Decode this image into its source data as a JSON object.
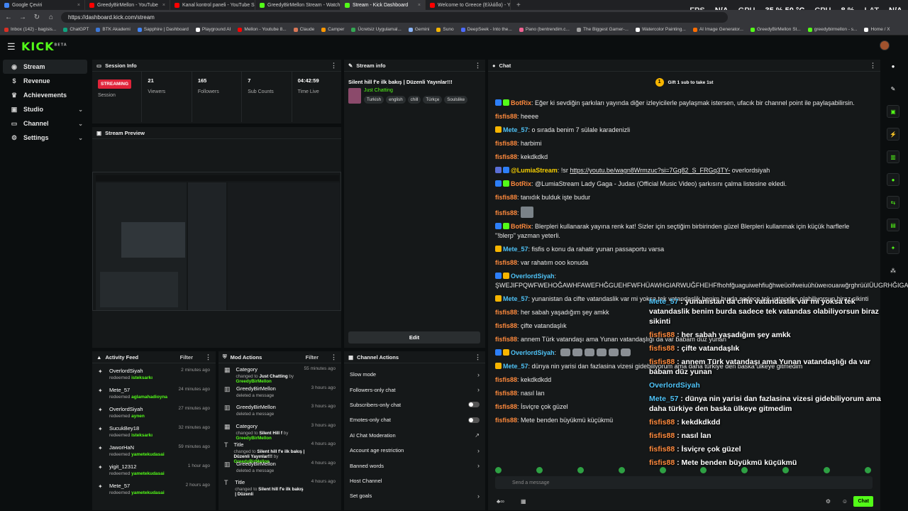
{
  "browser": {
    "tabs": [
      {
        "label": "Google Çeviri",
        "color": "#4285f4"
      },
      {
        "label": "GreedyBirMellon - YouTube",
        "color": "#ff0000"
      },
      {
        "label": "Kanal kontrol paneli - YouTube S...",
        "color": "#ff0000"
      },
      {
        "label": "GreedyBirMellon Stream - Watch...",
        "color": "#53fc18"
      },
      {
        "label": "Stream - Kick Dashboard",
        "color": "#53fc18"
      },
      {
        "label": "Welcome to Greece (Ελλάδα) - Yo...",
        "color": "#ff0000"
      }
    ],
    "url": "https://dashboard.kick.com/stream",
    "bookmarks": [
      "Inbox (142) - bagisis...",
      "ChatGPT",
      "BTK Akademi",
      "Sapphire | Dashboard",
      "Playground AI",
      "Mellon - Youtube 8...",
      "Claude",
      "Camper",
      "Ücretsiz Uygulamal...",
      "Gemini",
      "Suno",
      "DeepSeek - Into the...",
      "Pano (bentrendim.c...",
      "The Biggest Gamer-...",
      "Watercolor Painting...",
      "AI Image Generator...",
      "GreedyBirMellon St...",
      "greedybirmellon - s...",
      "Home / X"
    ]
  },
  "hud": {
    "fps_label": "FPS",
    "fps": "N/A",
    "gpu_label": "GPU",
    "gpu": "35 % 50 °C",
    "cpu_label": "CPU",
    "cpu": "8 %",
    "lat_label": "LAT",
    "lat": "N/A"
  },
  "app": {
    "logo": "KICK",
    "logo_tag": "BETA"
  },
  "sidebar": {
    "items": [
      {
        "label": "Stream",
        "icon": "broadcast-icon",
        "glyph": "◉"
      },
      {
        "label": "Revenue",
        "icon": "dollar-icon",
        "glyph": "$"
      },
      {
        "label": "Achievements",
        "icon": "trophy-icon",
        "glyph": "♛"
      },
      {
        "label": "Studio",
        "icon": "studio-icon",
        "glyph": "▣"
      },
      {
        "label": "Channel",
        "icon": "channel-icon",
        "glyph": "▭"
      },
      {
        "label": "Settings",
        "icon": "gear-icon",
        "glyph": "⚙"
      }
    ]
  },
  "session": {
    "title": "Session Info",
    "status": "STREAMING",
    "session_label": "Session",
    "viewers": "21",
    "viewers_label": "Viewers",
    "followers": "165",
    "followers_label": "Followers",
    "subs": "7",
    "subs_label": "Sub Counts",
    "time": "04:42:59",
    "time_label": "Time Live"
  },
  "stream_info": {
    "title": "Stream info",
    "stream_title": "Silent hill f'e ilk bakış | Düzenli Yayınlar!!!",
    "category": "Just Chatting",
    "tags": [
      "Turkish",
      "english",
      "chill",
      "Türkçe",
      "Soulslike"
    ],
    "edit_label": "Edit"
  },
  "preview": {
    "title": "Stream Preview"
  },
  "activity": {
    "title": "Activity Feed",
    "filter_label": "Filter",
    "items": [
      {
        "name": "OverlordSiyah",
        "action": "redeemed",
        "reward": "isteksarkı",
        "time": "2 minutes ago"
      },
      {
        "name": "Mete_57",
        "action": "redeemed",
        "reward": "aglamahadioyna",
        "time": "24 minutes ago"
      },
      {
        "name": "OverlordSiyah",
        "action": "redeemed",
        "reward": "aynen",
        "time": "27 minutes ago"
      },
      {
        "name": "SucukBey18",
        "action": "redeemed",
        "reward": "isteksarkı",
        "time": "32 minutes ago"
      },
      {
        "name": "JaworHaN",
        "action": "redeemed",
        "reward": "yametekudasai",
        "time": "59 minutes ago"
      },
      {
        "name": "yigit_12312",
        "action": "redeemed",
        "reward": "yametekudasai",
        "time": "1 hour ago"
      },
      {
        "name": "Mete_57",
        "action": "redeemed",
        "reward": "yametekudasai",
        "time": "2 hours ago"
      }
    ]
  },
  "mod_actions": {
    "title": "Mod Actions",
    "filter_label": "Filter",
    "items": [
      {
        "name": "Category",
        "pre": "changed to",
        "target": "Just Chatting",
        "by": "by",
        "who": "GreedyBirMellon",
        "time": "55 minutes ago",
        "glyph": "▦"
      },
      {
        "name": "GreedyBirMellon",
        "pre": "deleted a message",
        "target": "",
        "by": "",
        "who": "",
        "time": "3 hours ago",
        "glyph": "🗑"
      },
      {
        "name": "GreedyBirMellon",
        "pre": "deleted a message",
        "target": "",
        "by": "",
        "who": "",
        "time": "3 hours ago",
        "glyph": "🗑"
      },
      {
        "name": "Category",
        "pre": "changed to",
        "target": "Silent Hill f",
        "by": "by",
        "who": "GreedyBirMellon",
        "time": "3 hours ago",
        "glyph": "▦"
      },
      {
        "name": "Title",
        "pre": "changed to",
        "target": "Silent hill f'e ilk bakış | Düzenli Yayınlar!!!",
        "by": "by",
        "who": "GreedyBirMellon",
        "time": "4 hours ago",
        "glyph": "T"
      },
      {
        "name": "GreedyBirMellon",
        "pre": "deleted a message",
        "target": "",
        "by": "",
        "who": "",
        "time": "4 hours ago",
        "glyph": "🗑"
      },
      {
        "name": "Title",
        "pre": "changed to",
        "target": "Silent hill f'e ilk bakış | Düzenli",
        "by": "",
        "who": "",
        "time": "4 hours ago",
        "glyph": "T"
      }
    ]
  },
  "channel_actions": {
    "title": "Channel Actions",
    "items": [
      {
        "label": "Slow mode",
        "kind": "arrow"
      },
      {
        "label": "Followers-only chat",
        "kind": "arrow"
      },
      {
        "label": "Subscribers-only chat",
        "kind": "toggle"
      },
      {
        "label": "Emotes-only chat",
        "kind": "toggle"
      },
      {
        "label": "AI Chat Moderation",
        "kind": "external"
      },
      {
        "label": "Account age restriction",
        "kind": "arrow"
      },
      {
        "label": "Banned words",
        "kind": "arrow"
      },
      {
        "label": "Host Channel",
        "kind": "none"
      },
      {
        "label": "Set goals",
        "kind": "arrow"
      }
    ]
  },
  "chat": {
    "title": "Chat",
    "pin_coin": "1",
    "pin_text": "Gift 1 sub to take 1st",
    "input_placeholder": "Send a message",
    "send_label": "Chat",
    "messages": [
      {
        "user": "BotRix",
        "color": "#ff8a3d",
        "badges": [
          "#2d7ff9",
          "#53fc18"
        ],
        "text": "Eğer ki sevdiğin şarkıları yayında diğer izleyicilerle paylaşmak istersen, ufacık bir channel point ile paylaşabilirsin.",
        "link": ""
      },
      {
        "user": "fisfis88",
        "color": "#ff8a3d",
        "badges": [],
        "text": "heeee",
        "link": ""
      },
      {
        "user": "Mete_57",
        "color": "#4fc3f7",
        "badges": [
          "#f7b500"
        ],
        "text": "o sırada benim 7 sülale karadenizli",
        "link": ""
      },
      {
        "user": "fisfis88",
        "color": "#ff8a3d",
        "badges": [],
        "text": "harbimi",
        "link": ""
      },
      {
        "user": "fisfis88",
        "color": "#ff8a3d",
        "badges": [],
        "text": "kekdkdkd",
        "link": ""
      },
      {
        "user": "@LumiaStream",
        "color": "#f7d000",
        "badges": [
          "#5a6fd6",
          "#2d7ff9"
        ],
        "text": "!sr",
        "link": "https://youtu.be/wagn8Wrmzuc?si=7Gq82_S_FRGq3TY-",
        "after": " overlordsiyah"
      },
      {
        "user": "BotRix",
        "color": "#ff8a3d",
        "badges": [
          "#2d7ff9",
          "#53fc18"
        ],
        "text": "@LumiaStream Lady Gaga - Judas (Official Music Video) şarkısını çalma listesine ekledi.",
        "link": ""
      },
      {
        "user": "fisfis88",
        "color": "#ff8a3d",
        "badges": [],
        "text": "tanıdık bulduk işte budur",
        "link": ""
      },
      {
        "user": "fisfis88",
        "color": "#ff8a3d",
        "badges": [],
        "text": "",
        "link": "",
        "sticker": true
      },
      {
        "user": "BotRix",
        "color": "#ff8a3d",
        "badges": [
          "#2d7ff9",
          "#53fc18"
        ],
        "text": "Blerpleri kullanarak yayına renk kat! Sizler için seçtiğim birbirinden güzel Blerpleri kullanmak için küçük harflerle \"!blerp\" yazman yeterli.",
        "link": ""
      },
      {
        "user": "Mete_57",
        "color": "#4fc3f7",
        "badges": [
          "#f7b500"
        ],
        "text": "fisfis o konu da rahatir yunan passaportu varsa",
        "link": ""
      },
      {
        "user": "fisfis88",
        "color": "#ff8a3d",
        "badges": [],
        "text": "var rahatım ooo konuda",
        "link": ""
      },
      {
        "user": "OverlordSiyah",
        "color": "#4fc3f7",
        "badges": [
          "#2d7ff9",
          "#f7b500"
        ],
        "text": "ŞWEJIFPQWFWEHOĞAWHFAWEFHĞGUEHFWFHÜAWHGIARWUĞFHEHFfhohfğuaguiwehfiuğhweüoifweiuühüweıouaıwğrghrüüIÜUGRHĞIGAWEIÜÜ",
        "link": ""
      },
      {
        "user": "Mete_57",
        "color": "#4fc3f7",
        "badges": [
          "#f7b500"
        ],
        "text": "yunanistan da cifte vatandaslik var mi yoksa tek vatandaslik benim burda sadece tek vatandas olabiliyorsun biraz sikinti",
        "link": ""
      },
      {
        "user": "fisfis88",
        "color": "#ff8a3d",
        "badges": [],
        "text": "her sabah yaşadığım şey amkk",
        "link": ""
      },
      {
        "user": "fisfis88",
        "color": "#ff8a3d",
        "badges": [],
        "text": "çifte vatandaşlık",
        "link": ""
      },
      {
        "user": "fisfis88",
        "color": "#ff8a3d",
        "badges": [],
        "text": "annem Türk vatandaşı ama Yunan vatandaşlığı da var babam düz yunan",
        "link": ""
      },
      {
        "user": "OverlordSiyah",
        "color": "#4fc3f7",
        "badges": [
          "#2d7ff9",
          "#f7b500"
        ],
        "text": "",
        "link": "",
        "emotes": 6
      },
      {
        "user": "Mete_57",
        "color": "#4fc3f7",
        "badges": [
          "#f7b500"
        ],
        "text": "dünya nin yarisi dan fazlasina vizesi gidebiliyorum ama daha türkiye den baska ülkeye gitmedim",
        "link": ""
      },
      {
        "user": "fisfis88",
        "color": "#ff8a3d",
        "badges": [],
        "text": "kekdkdkdd",
        "link": ""
      },
      {
        "user": "fisfis88",
        "color": "#ff8a3d",
        "badges": [],
        "text": "nasıl lan",
        "link": ""
      },
      {
        "user": "fisfis88",
        "color": "#ff8a3d",
        "badges": [],
        "text": "İsviçre çok güzel",
        "link": ""
      },
      {
        "user": "fisfis88",
        "color": "#ff8a3d",
        "badges": [],
        "text": "Mete benden büyükmü küçükmü",
        "link": ""
      }
    ],
    "overlay": [
      {
        "user": "Mete_57",
        "blue": true,
        "text": "yunanistan da cifte vatandaslik var mi yoksa tek vatandaslik benim burda sadece tek vatandas olabiliyorsun biraz sikinti"
      },
      {
        "user": "fisfis88",
        "blue": false,
        "text": "her sabah yaşadığım şey amkk"
      },
      {
        "user": "fisfis88",
        "blue": false,
        "text": "çifte vatandaşlık"
      },
      {
        "user": "fisfis88",
        "blue": false,
        "text": "annem Türk vatandaşı ama Yunan vatandaşlığı da var babam düz yunan"
      },
      {
        "user": "OverlordSiyah",
        "blue": true,
        "text": ""
      },
      {
        "user": "Mete_57",
        "blue": true,
        "text": "dünya nin yarisi dan fazlasina vizesi gidebiliyorum ama daha türkiye den baska ülkeye gitmedim"
      },
      {
        "user": "fisfis88",
        "blue": false,
        "text": "kekdkdkdd"
      },
      {
        "user": "fisfis88",
        "blue": false,
        "text": "nasıl lan"
      },
      {
        "user": "fisfis88",
        "blue": false,
        "text": "İsviçre çok güzel"
      },
      {
        "user": "fisfis88",
        "blue": false,
        "text": "Mete benden büyükmü küçükmü"
      }
    ]
  },
  "rail": {
    "items": [
      {
        "icon": "info-icon",
        "glyph": "●",
        "white": true
      },
      {
        "icon": "pencil-icon",
        "glyph": "✎",
        "white": true
      },
      {
        "icon": "layout-icon",
        "glyph": "▣",
        "white": false
      },
      {
        "icon": "bolt-icon",
        "glyph": "⚡",
        "white": false
      },
      {
        "icon": "trash-icon",
        "glyph": "▥",
        "white": false
      },
      {
        "icon": "chat-bubble-icon",
        "glyph": "●",
        "white": false
      },
      {
        "icon": "link-icon",
        "glyph": "⇆",
        "white": false
      },
      {
        "icon": "calendar-icon",
        "glyph": "▤",
        "white": false
      },
      {
        "icon": "wrench-icon",
        "glyph": "✦",
        "white": false
      },
      {
        "icon": "nodes-icon",
        "glyph": "⁂",
        "white": true
      }
    ]
  }
}
